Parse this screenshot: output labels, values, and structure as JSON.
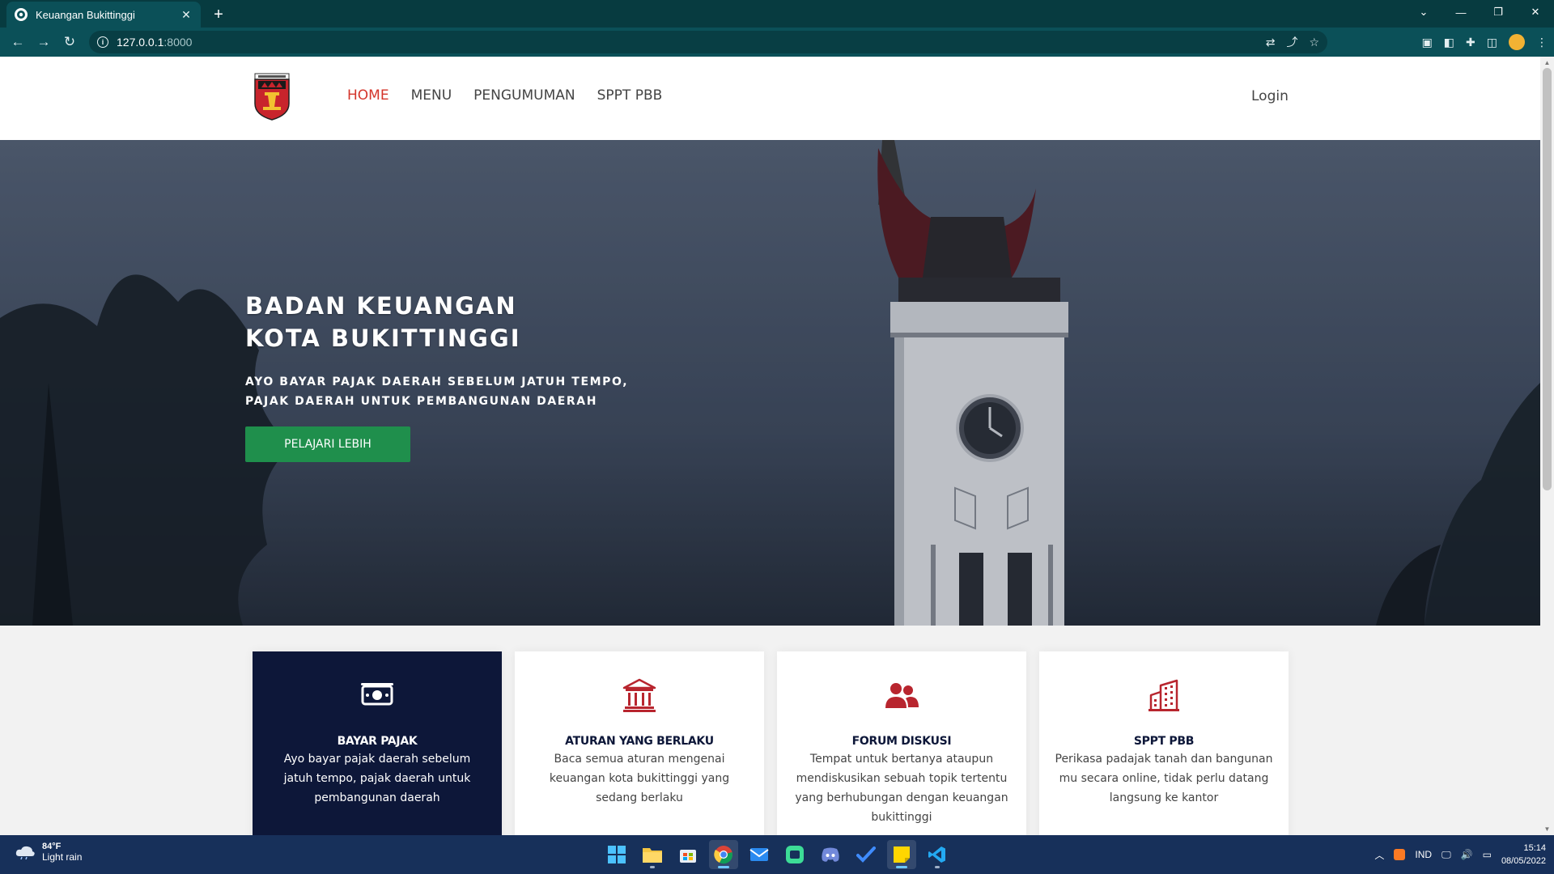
{
  "browser": {
    "tab_title": "Keuangan Bukittinggi",
    "tab_close": "✕",
    "new_tab": "+",
    "url_host": "127.0.0.1",
    "url_port": ":8000"
  },
  "site": {
    "nav": {
      "home": "HOME",
      "menu": "MENU",
      "pengumuman": "PENGUMUMAN",
      "sppt": "SPPT PBB"
    },
    "login": "Login",
    "hero": {
      "title_line1": "BADAN KEUANGAN",
      "title_line2": "KOTA BUKITTINGGI",
      "sub_line1": "AYO BAYAR PAJAK DAERAH SEBELUM JATUH TEMPO,",
      "sub_line2": "PAJAK DAERAH UNTUK PEMBANGUNAN DAERAH",
      "button": "PELAJARI LEBIH"
    },
    "cards": [
      {
        "icon": "money-icon",
        "title": "BAYAR PAJAK",
        "text": "Ayo bayar pajak daerah sebelum jatuh tempo, pajak daerah untuk pembangunan daerah"
      },
      {
        "icon": "bank-icon",
        "title": "ATURAN YANG BERLAKU",
        "text": "Baca semua aturan mengenai keuangan kota bukittinggi yang sedang berlaku"
      },
      {
        "icon": "users-icon",
        "title": "FORUM DISKUSI",
        "text": "Tempat untuk bertanya ataupun mendiskusikan sebuah topik tertentu yang berhubungan dengan keuangan bukittinggi"
      },
      {
        "icon": "building-icon",
        "title": "SPPT PBB",
        "text": "Perikasa padajak tanah dan bangunan mu secara online, tidak perlu datang langsung ke kantor"
      }
    ]
  },
  "taskbar": {
    "weather_temp": "84°F",
    "weather_desc": "Light rain",
    "lang": "IND",
    "time": "15:14",
    "date": "08/05/2022"
  },
  "colors": {
    "accent_red": "#d4342a",
    "button_green": "#1f8f4c",
    "card_dark": "#0d1739",
    "icon_red": "#b8252e"
  }
}
